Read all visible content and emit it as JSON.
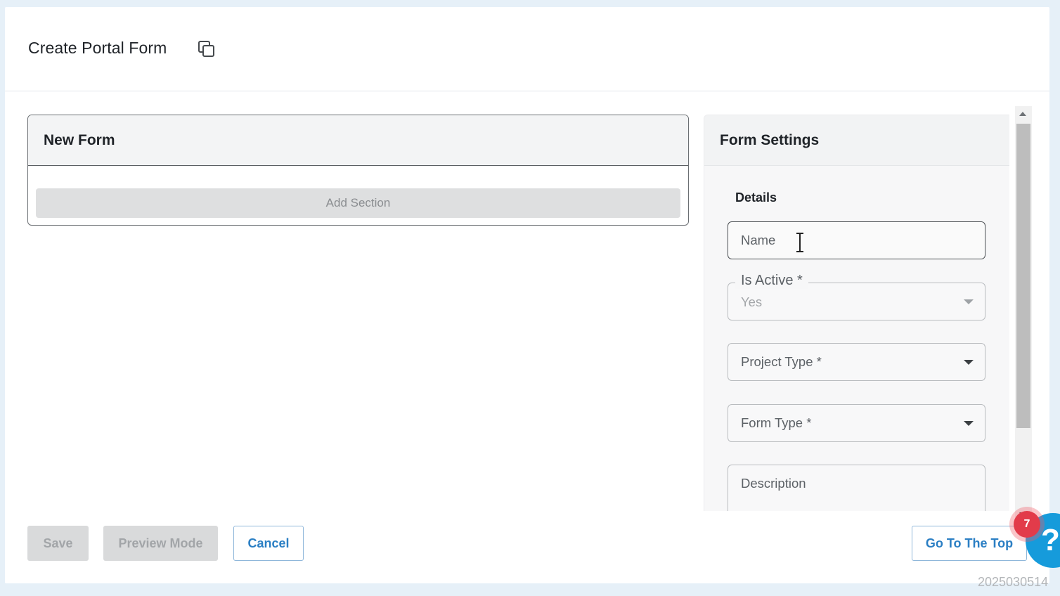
{
  "header": {
    "title": "Create Portal Form",
    "copy_icon": "copy-icon"
  },
  "form_panel": {
    "title": "New Form",
    "add_section_label": "Add Section"
  },
  "settings": {
    "title": "Form Settings",
    "section_label": "Details",
    "fields": {
      "name": {
        "placeholder": "Name",
        "value": ""
      },
      "is_active": {
        "label": "Is Active *",
        "value": "Yes"
      },
      "project_type": {
        "placeholder": "Project Type *"
      },
      "form_type": {
        "placeholder": "Form Type *"
      },
      "description": {
        "placeholder": "Description"
      }
    }
  },
  "footer": {
    "save_label": "Save",
    "preview_label": "Preview Mode",
    "cancel_label": "Cancel",
    "go_top_label": "Go To The Top"
  },
  "help": {
    "icon": "?",
    "badge_count": "7"
  },
  "build_id": "2025030514",
  "colors": {
    "accent": "#2b7fc4",
    "help_button": "#169bdb",
    "badge": "#e23b4a",
    "page_background": "#e6f0f8"
  }
}
